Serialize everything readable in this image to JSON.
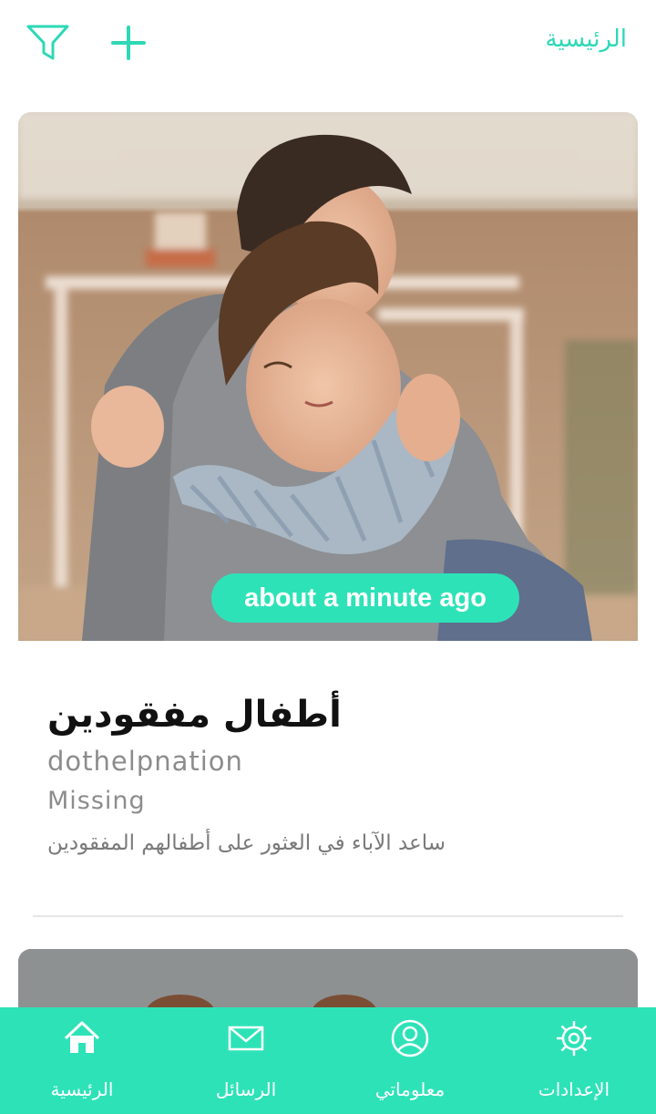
{
  "header": {
    "title": "الرئيسية",
    "filter_icon": "filter-icon",
    "add_icon": "plus-icon"
  },
  "card": {
    "time_badge": "about a minute ago",
    "title": "أطفال مفقودين",
    "user": "dothelpnation",
    "category": "Missing",
    "description": "ساعد الآباء في العثور على أطفالهم المفقودين",
    "image": "photo of a father hugging a young boy"
  },
  "bottom_nav": {
    "items": [
      {
        "label": "الرئيسية",
        "icon": "home-icon"
      },
      {
        "label": "الرسائل",
        "icon": "envelope-icon"
      },
      {
        "label": "معلوماتي",
        "icon": "profile-icon"
      },
      {
        "label": "الإعدادات",
        "icon": "gear-icon"
      }
    ]
  },
  "colors": {
    "accent": "#2ee2b8",
    "accent_text": "#2ed8b6",
    "muted_text": "#8c8c8c"
  }
}
